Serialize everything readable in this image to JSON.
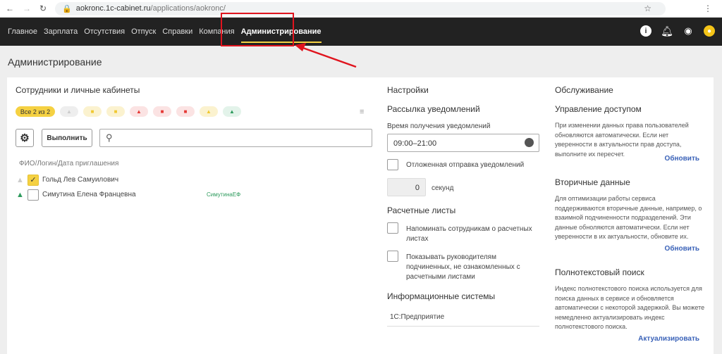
{
  "browser": {
    "url_domain": "aokronc.1c-cabinet.ru",
    "url_path": "/applications/aokronc/"
  },
  "nav": {
    "items": [
      "Главное",
      "Зарплата",
      "Отсутствия",
      "Отпуск",
      "Справки",
      "Компания",
      "Администрирование"
    ],
    "active": "Администрирование"
  },
  "page_title": "Администрирование",
  "employees": {
    "title": "Сотрудники и личные кабинеты",
    "all_chip": "Все 2 из 2",
    "execute": "Выполнить",
    "search_placeholder": "",
    "column": "ФИО/Логин/Дата приглашения",
    "rows": [
      {
        "name": "Гольд Лев Самуилович",
        "login": "",
        "checked": true
      },
      {
        "name": "Симутина Елена Францевна",
        "login": "СимутинаЕФ",
        "checked": false
      }
    ]
  },
  "settings": {
    "title": "Настройки",
    "notifications": "Рассылка уведомлений",
    "time_label": "Время получения уведомлений",
    "time_value": "09:00–21:00",
    "delayed": "Отложенная отправка уведомлений",
    "seconds_value": "0",
    "seconds_label": "секунд",
    "payslips": "Расчетные листы",
    "remind": "Напоминать сотрудникам о расчетных листах",
    "show_managers": "Показывать руководителям подчиненных, не ознакомленных с расчетными листами",
    "infosys": "Информационные системы",
    "infosys_value": "1С:Предприятие"
  },
  "service": {
    "title": "Обслуживание",
    "access_title": "Управление доступом",
    "access_desc": "При изменении данных права пользователей обновляются автоматически. Если нет уверенности в актуальности прав доступа, выполните их пересчет.",
    "access_link": "Обновить",
    "secondary_title": "Вторичные данные",
    "secondary_desc": "Для оптимизации работы сервиса поддерживаются вторичные данные, например, о взаимной подчиненности подразделений. Эти данные обноляются автоматически. Если нет уверенности в их актуальности, обновите их.",
    "secondary_link": "Обновить",
    "fts_title": "Полнотекстовый поиск",
    "fts_desc": "Индекс полнотекстового поиска используется для поиска данных в сервисе и обновляется автоматически с некоторой задержкой. Вы можете немедленно актуализировать индекс полнотекстового поиска.",
    "fts_link": "Актуализировать"
  }
}
